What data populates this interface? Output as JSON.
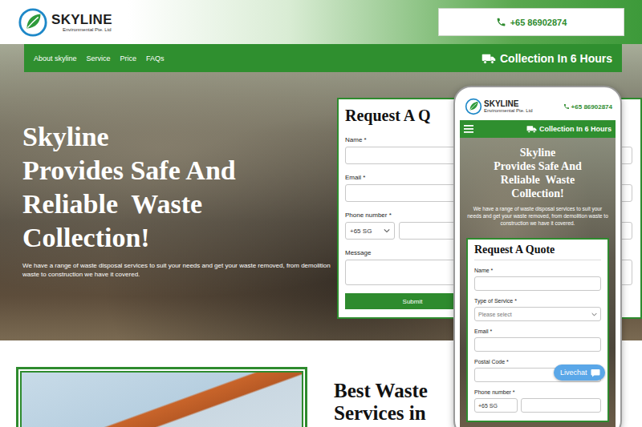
{
  "header": {
    "brand": "SKYLINE",
    "brand_sub": "Environmental Pte. Ltd",
    "phone": "+65 86902874"
  },
  "nav": {
    "items": [
      {
        "label": "About skyline"
      },
      {
        "label": "Service"
      },
      {
        "label": "Price"
      },
      {
        "label": "FAQs"
      }
    ],
    "badge": "Collection In 6 Hours"
  },
  "hero": {
    "title_lines": [
      "Skyline",
      "Provides Safe And",
      "Reliable  Waste",
      "Collection!"
    ],
    "text": "We have a range of waste disposal services to suit your needs and get your waste removed, from demolition waste to construction we have it covered."
  },
  "quote_form": {
    "title": "Request A Q",
    "fields": [
      {
        "label": "Name *",
        "kind": "input"
      },
      {
        "label": "Email *",
        "kind": "input"
      },
      {
        "label": "Phone number *",
        "kind": "phone",
        "value": "+65 SG"
      },
      {
        "label": "Message",
        "kind": "textarea"
      }
    ],
    "submit": "Submit"
  },
  "section": {
    "heading_lines": [
      "Best Waste",
      "Services in"
    ]
  },
  "mobile": {
    "brand": "SKYLINE",
    "brand_sub": "Environmental Pte. Ltd",
    "phone": "+65 86902874",
    "badge": "Collection In 6 Hours",
    "title_lines": [
      "Skyline",
      "Provides Safe And",
      "Reliable  Waste",
      "Collection!"
    ],
    "text": "We have a range of waste disposal services to suit your needs and get your waste removed, from demolition waste to construction we have it covered.",
    "form_title": "Request A Quote",
    "fields": [
      {
        "label": "Name *",
        "kind": "input"
      },
      {
        "label": "Type of Service *",
        "kind": "select",
        "value": "Please select"
      },
      {
        "label": "Email *",
        "kind": "input"
      },
      {
        "label": "Postal Code *",
        "kind": "input"
      },
      {
        "label": "Phone number *",
        "kind": "phone",
        "value": "+65 SG"
      }
    ],
    "livechat": "Livechat"
  }
}
